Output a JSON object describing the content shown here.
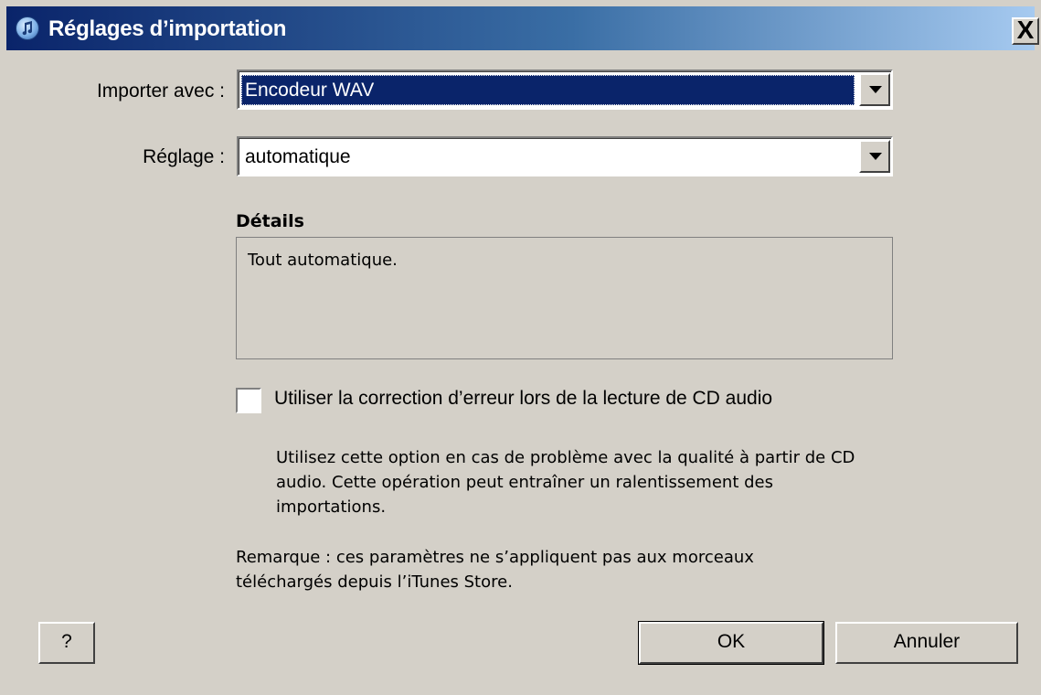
{
  "window": {
    "title": "Réglages d’importation",
    "close_label": "X"
  },
  "form": {
    "import_label": "Importer avec :",
    "import_value": "Encodeur WAV",
    "setting_label": "Réglage :",
    "setting_value": "automatique"
  },
  "details": {
    "title": "Détails",
    "text": "Tout automatique."
  },
  "error_correction": {
    "checked": false,
    "label": "Utiliser la correction d’erreur lors de la lecture de CD audio",
    "help_line1": "Utilisez cette option en cas de problème avec la qualité à partir de CD",
    "help_line2": "audio. Cette opération peut entraîner un ralentissement des",
    "help_line3": "importations."
  },
  "note": {
    "line1": "Remarque : ces paramètres ne s’appliquent pas aux morceaux",
    "line2": "téléchargés depuis l’iTunes Store."
  },
  "buttons": {
    "help": "?",
    "ok": "OK",
    "cancel": "Annuler"
  },
  "icons": {
    "app": "itunes-note-icon",
    "dropdown": "chevron-down-icon"
  }
}
